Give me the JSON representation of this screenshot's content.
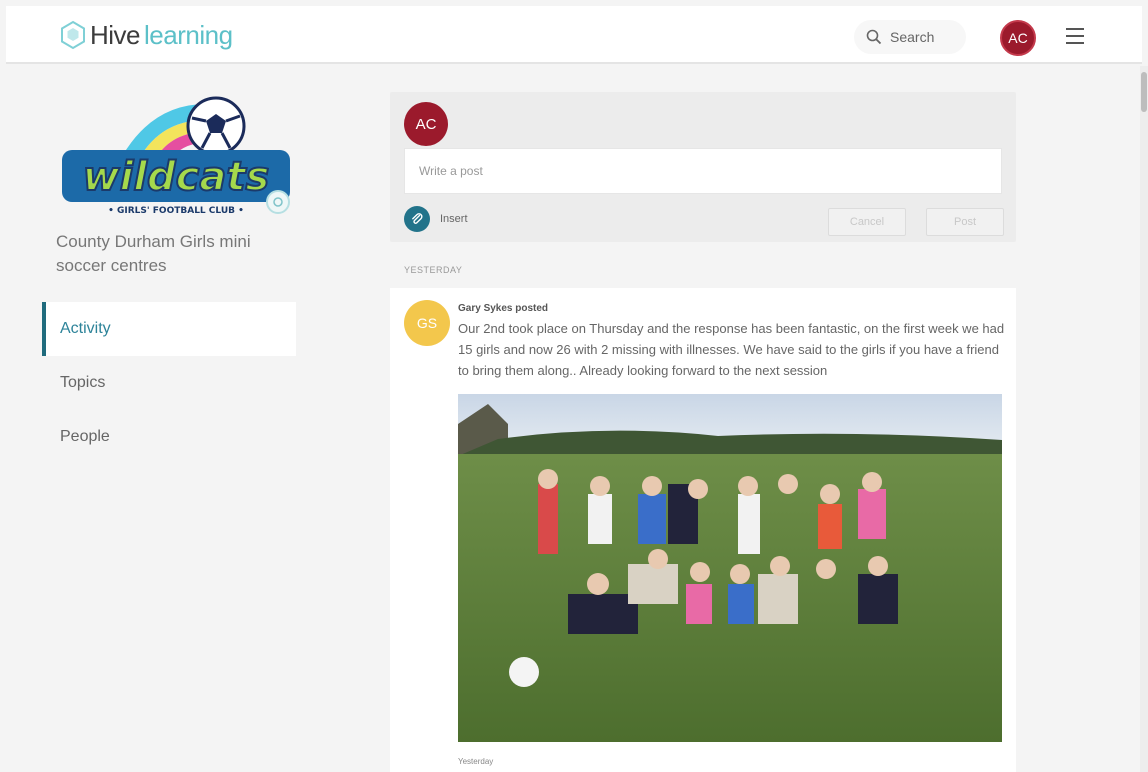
{
  "header": {
    "brand_part1": "Hive",
    "brand_part2": "learning",
    "search_label": "Search",
    "user_initials": "AC"
  },
  "group": {
    "logo_text": "wildcats",
    "logo_subtext": "• GIRLS' FOOTBALL CLUB •",
    "name": "County Durham Girls mini soccer centres"
  },
  "nav": {
    "items": [
      {
        "label": "Activity",
        "active": true
      },
      {
        "label": "Topics",
        "active": false
      },
      {
        "label": "People",
        "active": false
      }
    ]
  },
  "composer": {
    "avatar_initials": "AC",
    "placeholder": "Write a post",
    "insert_label": "Insert",
    "cancel_label": "Cancel",
    "post_label": "Post"
  },
  "feed": {
    "date_heading": "YESTERDAY",
    "post": {
      "avatar_initials": "GS",
      "author_line": "Gary Sykes posted",
      "text": "Our 2nd took place on Thursday and the response has been fantastic, on the first week we had 15 girls and now 26 with 2 missing with illnesses. We have said to the girls if you have a friend to bring them along.. Already looking forward to the next session",
      "caption": "Yesterday"
    }
  },
  "colors": {
    "brand_teal": "#5cc0c8",
    "user_avatar": "#9b1a2c",
    "poster_avatar": "#f3c74c",
    "active_nav_bar": "#1f6b7d"
  },
  "icons": {
    "logo": "hive-hexagon-icon",
    "search": "search-icon",
    "menu": "hamburger-menu-icon",
    "insert": "paperclip-icon"
  }
}
